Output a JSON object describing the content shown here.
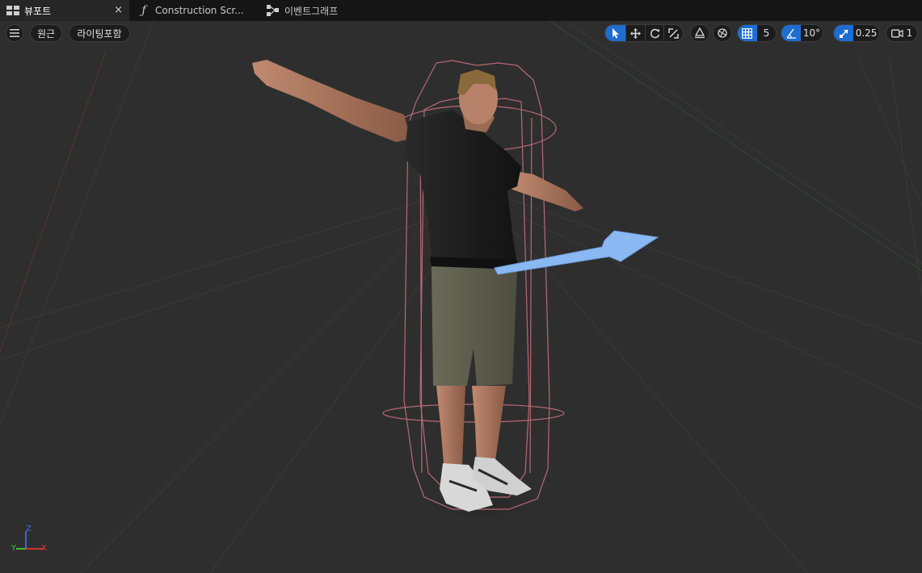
{
  "tabs": [
    {
      "label": "뷰포트",
      "close": "×"
    },
    {
      "label": "Construction Scr..."
    },
    {
      "label": "이벤트그래프"
    }
  ],
  "toolbar": {
    "left": {
      "view_mode": "원근",
      "lighting_mode": "라이팅포함"
    },
    "grid_snap_value": "5",
    "rotation_snap_value": "10°",
    "scale_snap_value": "0.25",
    "camera_speed_value": "1"
  },
  "axis_widget": {
    "z": "Z",
    "y": "Y",
    "x": "X"
  },
  "colors": {
    "accent": "#1e6dd1",
    "viewport_bg": "#2e2e2e",
    "tab_bg": "#151515",
    "axis_x": "#e83232",
    "axis_y": "#3fcc3f",
    "axis_z": "#3a6df0",
    "collision_capsule": "#c06874",
    "arrow_component": "#8ab8f2"
  },
  "icons": {
    "menu": "hamburger-icon",
    "select": "cursor-arrow-icon",
    "translate": "move-icon",
    "rotate": "rotate-icon",
    "scale": "scale-icon",
    "surface_snap": "surface-snap-icon",
    "transform_space": "world-space-icon",
    "grid": "grid-icon",
    "angle": "angle-icon",
    "scale_snap": "scale-snap-icon",
    "camera": "camera-icon"
  }
}
